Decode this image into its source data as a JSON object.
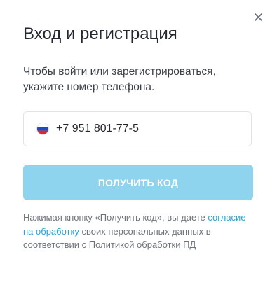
{
  "modal": {
    "title": "Вход и регистрация",
    "subtitle": "Чтобы войти или зарегистрироваться, укажите номер телефона.",
    "close_icon": "close-icon",
    "phone": {
      "country_flag": "russia-flag-icon",
      "value": "+7 951 801-77-5"
    },
    "submit_label": "ПОЛУЧИТЬ КОД",
    "consent": {
      "before_link": "Нажимая кнопку «Получить код», вы даете ",
      "link_text": "согласие на обработку",
      "after_link": " своих персональных данных в соответствии с Политикой обработки ПД"
    },
    "colors": {
      "button_disabled": "#8fd4ee",
      "link": "#27a3d6",
      "text": "#23272e",
      "muted": "#6d737b"
    }
  }
}
